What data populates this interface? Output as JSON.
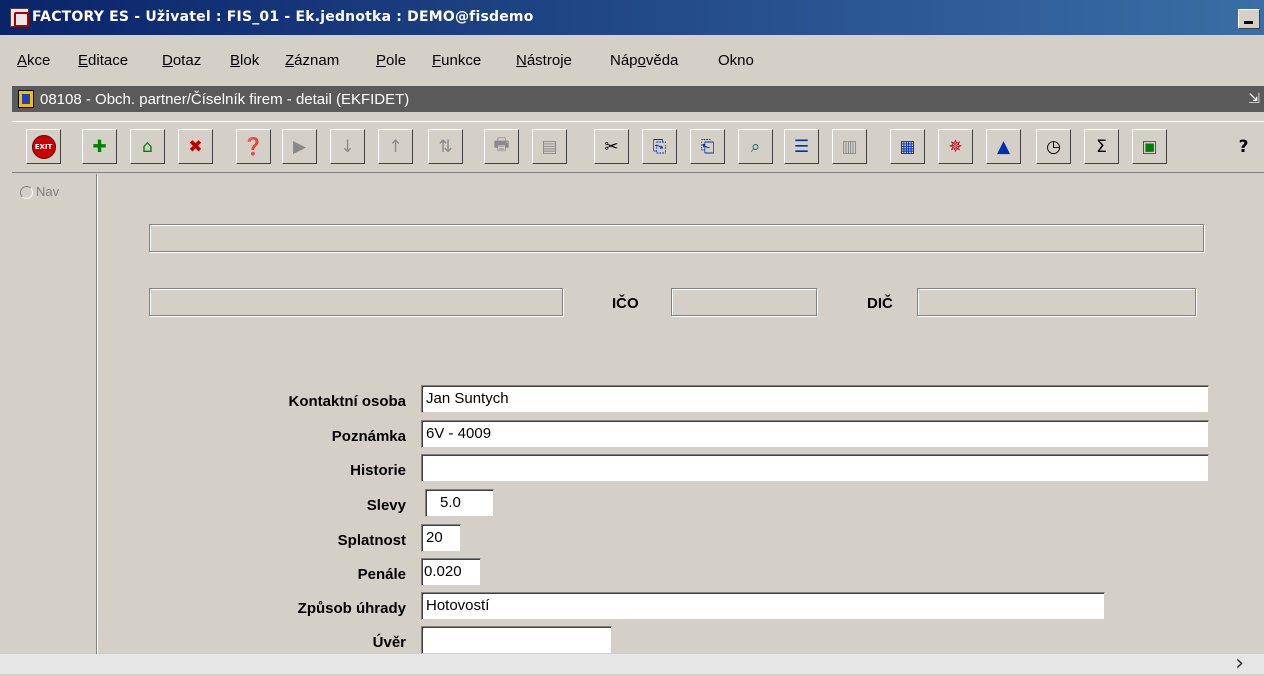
{
  "window": {
    "title": "FACTORY ES - Uživatel : FIS_01 - Ek.jednotka : DEMO@fisdemo"
  },
  "menu": [
    {
      "pre": "",
      "u": "A",
      "post": "kce"
    },
    {
      "pre": "",
      "u": "E",
      "post": "ditace"
    },
    {
      "pre": "",
      "u": "D",
      "post": "otaz"
    },
    {
      "pre": "",
      "u": "B",
      "post": "lok"
    },
    {
      "pre": "",
      "u": "Z",
      "post": "áznam"
    },
    {
      "pre": "",
      "u": "P",
      "post": "ole"
    },
    {
      "pre": "",
      "u": "F",
      "post": "unkce"
    },
    {
      "pre": "",
      "u": "N",
      "post": "ástroje"
    },
    {
      "pre": "Náp",
      "u": "o",
      "post": "věda"
    },
    {
      "pre": "Okno",
      "u": "",
      "post": ""
    }
  ],
  "form": {
    "title": "08108 - Obch. partner/Číselník firem - detail (EKFIDET)"
  },
  "toolbar": {
    "exit_label": "EXIT"
  },
  "nav": {
    "label": "Nav"
  },
  "fields": {
    "ico_label": "IČO",
    "dic_label": "DIČ",
    "kontaktni_osoba_label": "Kontaktní osoba",
    "kontaktni_osoba_value": "Jan Suntych",
    "poznamka_label": "Poznámka",
    "poznamka_value": "6V - 4009",
    "historie_label": "Historie",
    "historie_value": "",
    "slevy_label": "Slevy",
    "slevy_value": "5.0",
    "splatnost_label": "Splatnost",
    "splatnost_value": "20",
    "penale_label": "Penále",
    "penale_value": "0.020",
    "zpusob_uhrady_label": "Způsob úhrady",
    "zpusob_uhrady_value": "Hotovostí",
    "uver_label": "Úvěr",
    "uver_value": ""
  }
}
